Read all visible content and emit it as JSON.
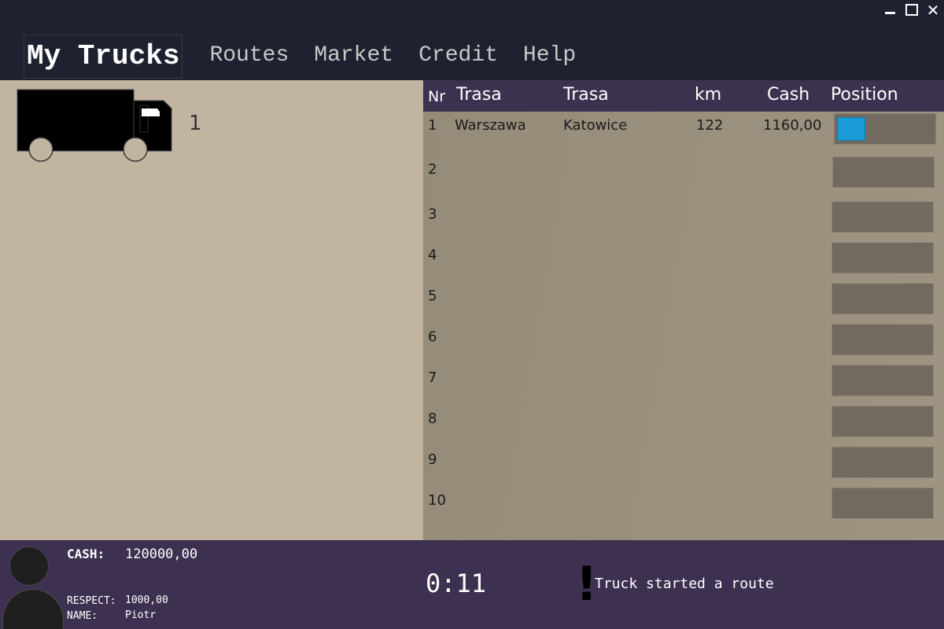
{
  "window": {
    "minimize_glyph": "",
    "maximize_glyph": "",
    "close_glyph": "✕"
  },
  "nav": {
    "tabs": [
      {
        "label": "My Trucks",
        "active": true
      },
      {
        "label": "Routes",
        "active": false
      },
      {
        "label": "Market",
        "active": false
      },
      {
        "label": "Credit",
        "active": false
      },
      {
        "label": "Help",
        "active": false
      }
    ]
  },
  "trucks": {
    "icon": "truck-icon",
    "count": "1"
  },
  "routes_table": {
    "columns": [
      "Nr",
      "Trasa",
      "Trasa",
      "km",
      "Cash",
      "Position"
    ],
    "rows": [
      {
        "nr": "1",
        "from": "Warszawa",
        "to": "Katowice",
        "km": "122",
        "cash": "1160,00",
        "progress": 0.3
      },
      {
        "nr": "2",
        "from": "",
        "to": "",
        "km": "",
        "cash": "",
        "progress": 0
      },
      {
        "nr": "3",
        "from": "",
        "to": "",
        "km": "",
        "cash": "",
        "progress": 0
      },
      {
        "nr": "4",
        "from": "",
        "to": "",
        "km": "",
        "cash": "",
        "progress": 0
      },
      {
        "nr": "5",
        "from": "",
        "to": "",
        "km": "",
        "cash": "",
        "progress": 0
      },
      {
        "nr": "6",
        "from": "",
        "to": "",
        "km": "",
        "cash": "",
        "progress": 0
      },
      {
        "nr": "7",
        "from": "",
        "to": "",
        "km": "",
        "cash": "",
        "progress": 0
      },
      {
        "nr": "8",
        "from": "",
        "to": "",
        "km": "",
        "cash": "",
        "progress": 0
      },
      {
        "nr": "9",
        "from": "",
        "to": "",
        "km": "",
        "cash": "",
        "progress": 0
      },
      {
        "nr": "10",
        "from": "",
        "to": "",
        "km": "",
        "cash": "",
        "progress": 0
      }
    ]
  },
  "status": {
    "cash_label": "CASH:",
    "cash_value": "120000,00",
    "respect_label": "RESPECT:",
    "respect_value": "1000,00",
    "name_label": "NAME:",
    "name_value": "Piotr",
    "timer": "0:11",
    "alert_icon": "!",
    "message": "Truck started a route"
  },
  "colors": {
    "topbar": "#1e2230",
    "left_pane": "#c1b4a1",
    "right_pane": "#958b79",
    "table_header": "#3d3150",
    "statusbar": "#3d3050",
    "progress_fill": "#1a9ad6"
  }
}
